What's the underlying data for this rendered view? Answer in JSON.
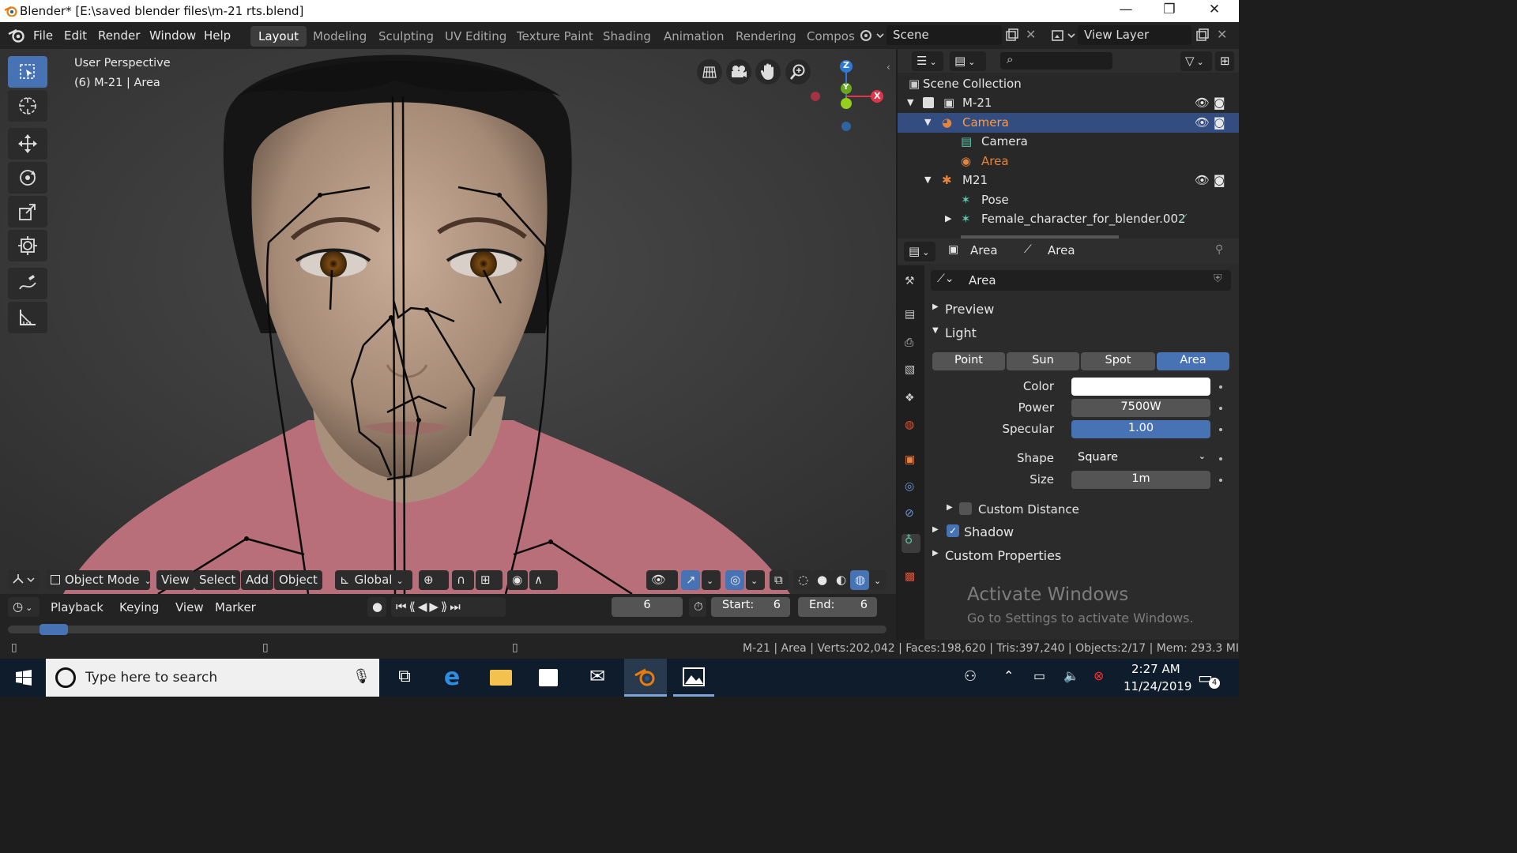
{
  "window": {
    "title": "Blender* [E:\\saved blender files\\m-21 rts.blend]",
    "minimize": "—",
    "restore": "❐",
    "close": "✕"
  },
  "menu": {
    "items": [
      "File",
      "Edit",
      "Render",
      "Window",
      "Help"
    ]
  },
  "workspaces": [
    "Layout",
    "Modeling",
    "Sculpting",
    "UV Editing",
    "Texture Paint",
    "Shading",
    "Animation",
    "Rendering",
    "Compos"
  ],
  "scene": {
    "name": "Scene"
  },
  "view_layer": {
    "name": "View Layer"
  },
  "viewport": {
    "view_name": "User Perspective",
    "active_info": "(6) M-21 | Area",
    "gizmo": {
      "z": "Z",
      "y": "Y",
      "x": "X"
    }
  },
  "viewport_header": {
    "mode": "Object Mode",
    "view": "View",
    "select": "Select",
    "add": "Add",
    "object": "Object",
    "orientation": "Global"
  },
  "timeline": {
    "playback": "Playback",
    "keying": "Keying",
    "view": "View",
    "marker": "Marker",
    "current_frame": "6",
    "start_label": "Start:",
    "start": "6",
    "end_label": "End:",
    "end": "6"
  },
  "outliner": {
    "root": "Scene Collection",
    "rows": [
      {
        "label": "M-21"
      },
      {
        "label": "Camera"
      },
      {
        "label": "Camera"
      },
      {
        "label": "Area"
      },
      {
        "label": "M21"
      },
      {
        "label": "Pose"
      },
      {
        "label": "Female_character_for_blender.002"
      }
    ]
  },
  "properties": {
    "context_object": "Area",
    "context_data": "Area",
    "datablock": "Area",
    "panels": {
      "preview": "Preview",
      "light": "Light",
      "custom_distance": "Custom Distance",
      "shadow": "Shadow",
      "custom_properties": "Custom Properties"
    },
    "light_types": [
      "Point",
      "Sun",
      "Spot",
      "Area"
    ],
    "active_light_type": "Area",
    "color_label": "Color",
    "color_value": "#ffffff",
    "power_label": "Power",
    "power": "7500W",
    "specular_label": "Specular",
    "specular": "1.00",
    "shape_label": "Shape",
    "shape": "Square",
    "size_label": "Size",
    "size": "1m",
    "shadow_enabled": true,
    "custom_distance_enabled": false
  },
  "watermark": {
    "line1": "Activate Windows",
    "line2": "Go to Settings to activate Windows."
  },
  "status": {
    "text": "M-21 | Area | Verts:202,042 | Faces:198,620 | Tris:397,240 | Objects:2/17 | Mem: 293.3 MI"
  },
  "taskbar": {
    "search_placeholder": "Type here to search",
    "time": "2:27 AM",
    "date": "11/24/2019",
    "notifications": "4"
  },
  "colors": {
    "accent": "#4772b3",
    "active_orange": "#e8833a",
    "bg": "#232323"
  }
}
